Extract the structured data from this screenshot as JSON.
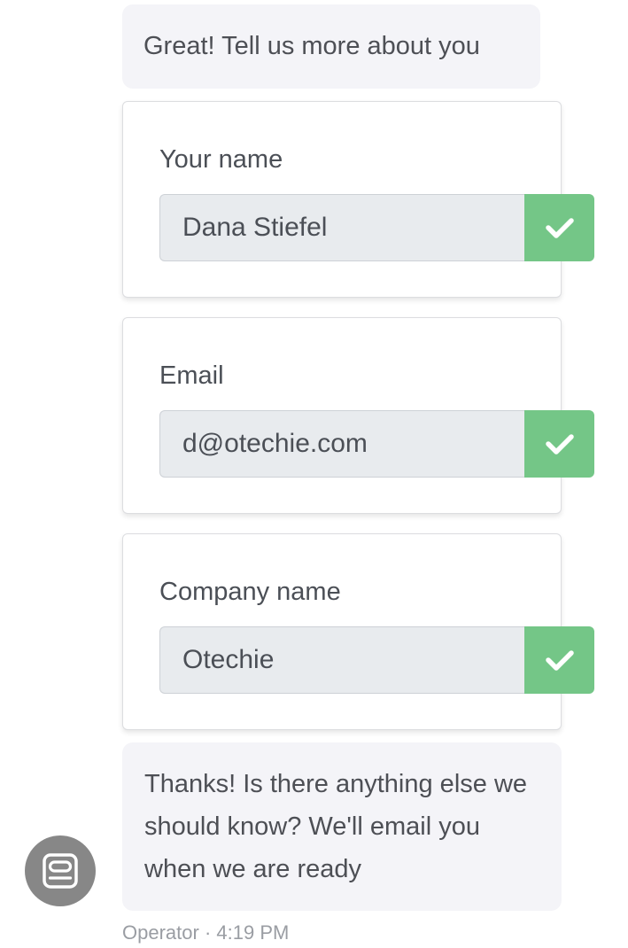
{
  "messages": {
    "greeting": "Great! Tell us more about you",
    "thanks": "Thanks! Is there anything else we should know? We'll email you when we are ready"
  },
  "form_cards": [
    {
      "label": "Your name",
      "value": "Dana Stiefel",
      "submit_icon": "checkmark-icon",
      "state": "submitted"
    },
    {
      "label": "Email",
      "value": "d@otechie.com",
      "submit_icon": "checkmark-icon",
      "state": "submitted"
    },
    {
      "label": "Company name",
      "value": "Otechie",
      "submit_icon": "checkmark-icon",
      "state": "submitted"
    }
  ],
  "footer": {
    "sender": "Operator",
    "separator": "·",
    "time": "4:19 PM"
  },
  "avatar": {
    "icon": "operator-avatar-icon",
    "color": "#878787"
  },
  "colors": {
    "bubble_bg": "#f4f4f8",
    "submit_green": "#74c687",
    "input_bg": "#e8ebee",
    "text": "#4b4f56",
    "meta_text": "#9a9da3"
  }
}
